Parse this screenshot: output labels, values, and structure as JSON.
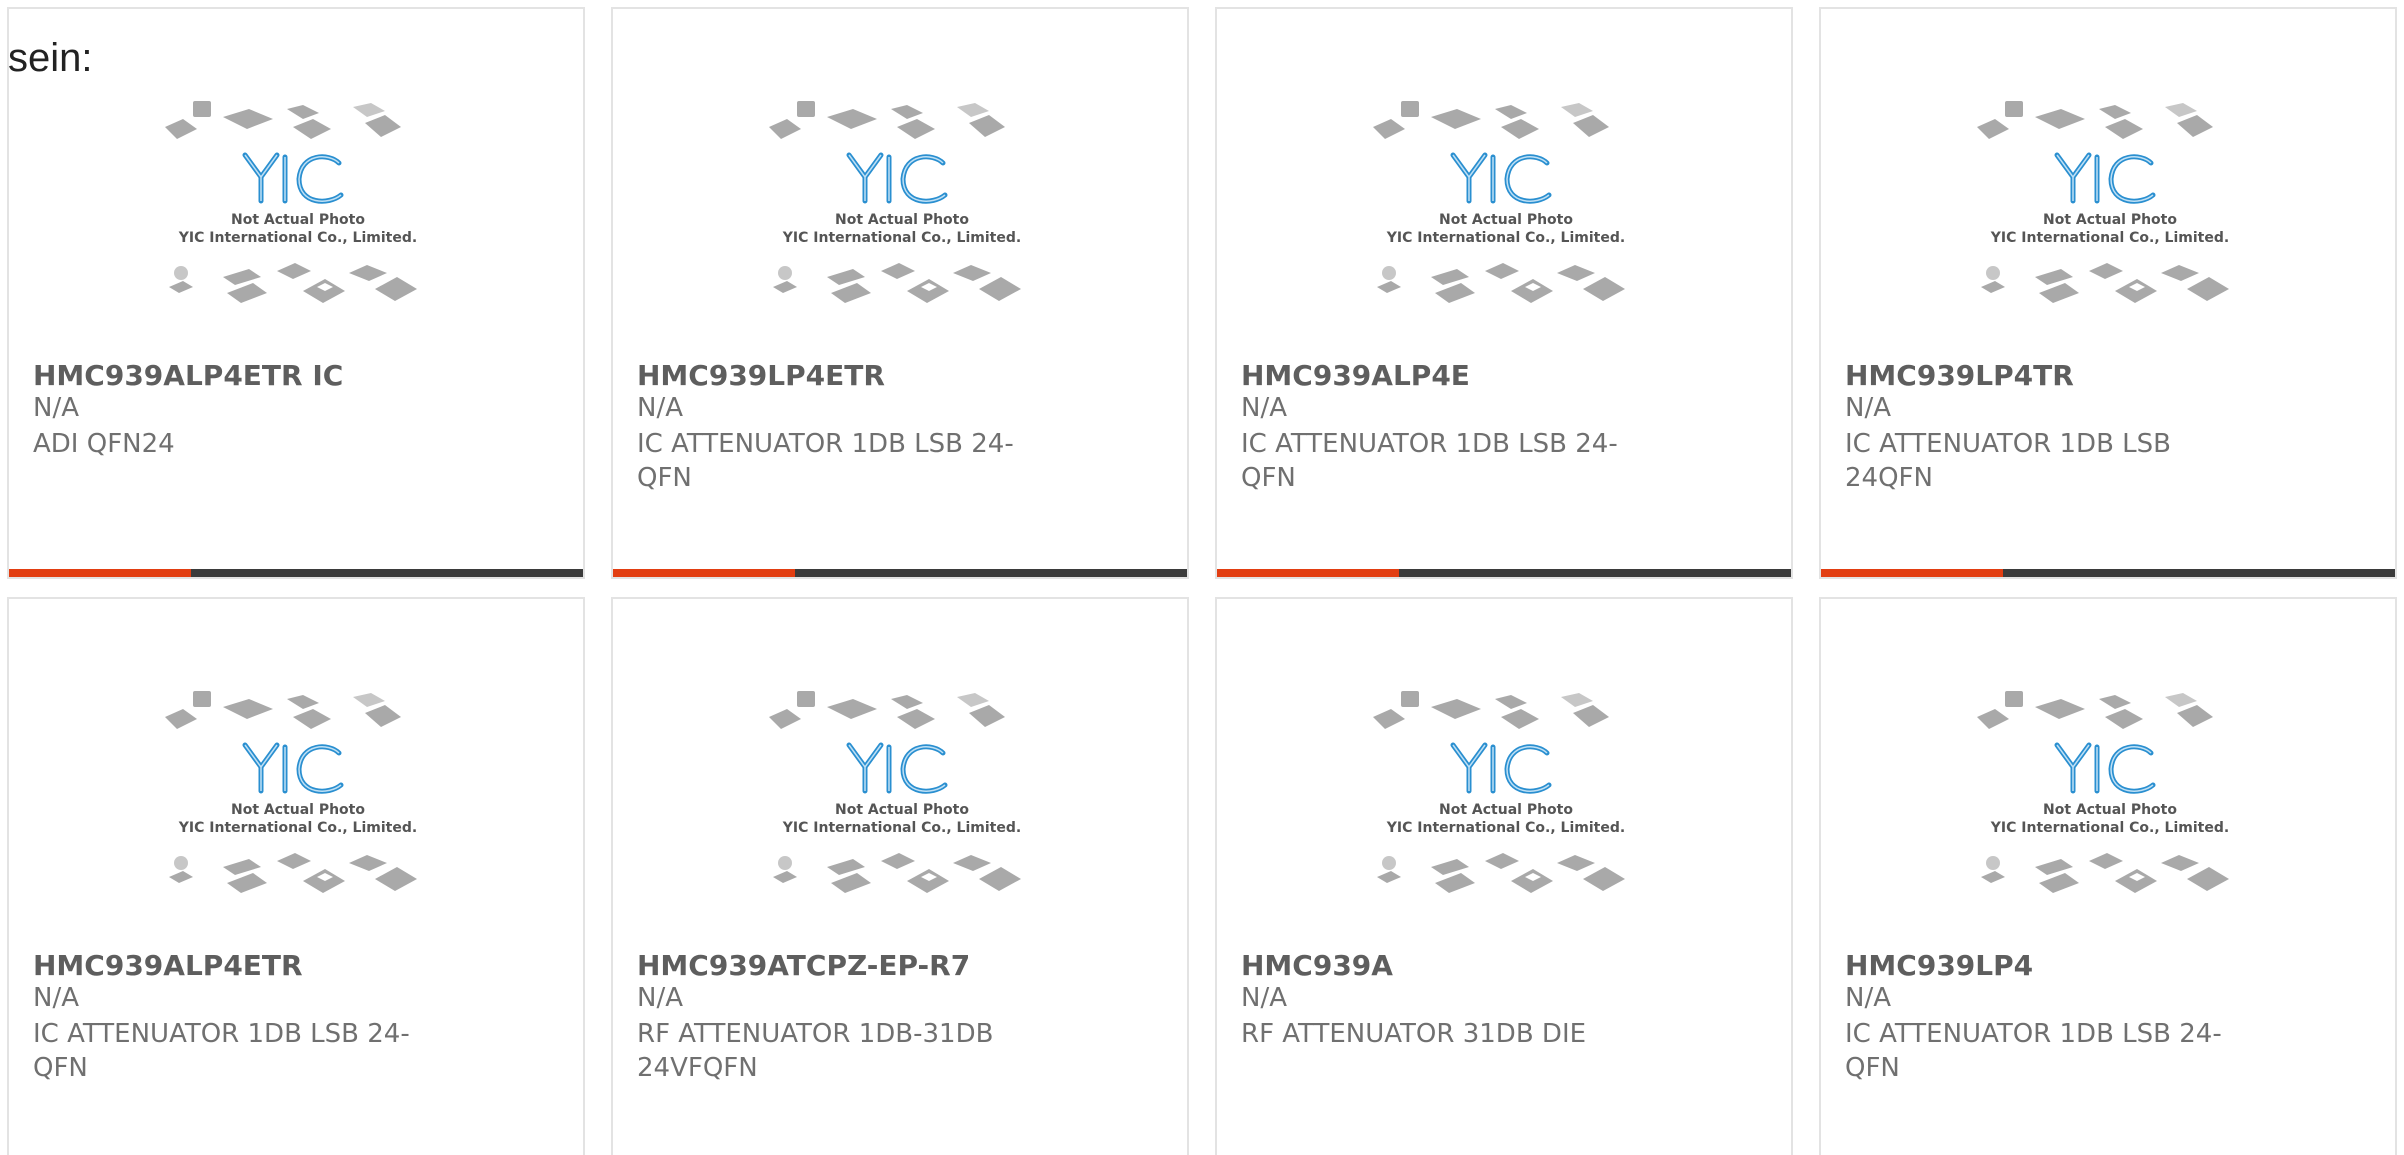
{
  "lead_text": "sein:",
  "brand": {
    "accent": "#e23e12",
    "bar": "#3b3b3b",
    "logo_blue": "#2a8fd0"
  },
  "placeholder": {
    "line1": "Not Actual Photo",
    "line2": "YIC International Co., Limited.",
    "logo": "YIC"
  },
  "products": [
    {
      "part": "HMC939ALP4ETR IC",
      "mfr": "N/A",
      "desc": "ADI QFN24"
    },
    {
      "part": "HMC939LP4ETR",
      "mfr": "N/A",
      "desc": "IC ATTENUATOR 1DB LSB 24-QFN"
    },
    {
      "part": "HMC939ALP4E",
      "mfr": "N/A",
      "desc": "IC ATTENUATOR 1DB LSB 24-QFN"
    },
    {
      "part": "HMC939LP4TR",
      "mfr": "N/A",
      "desc": "IC ATTENUATOR 1DB LSB 24QFN"
    },
    {
      "part": "HMC939ALP4ETR",
      "mfr": "N/A",
      "desc": "IC ATTENUATOR 1DB LSB 24-QFN"
    },
    {
      "part": "HMC939ATCPZ-EP-R7",
      "mfr": "N/A",
      "desc": "RF ATTENUATOR 1DB-31DB 24VFQFN"
    },
    {
      "part": "HMC939A",
      "mfr": "N/A",
      "desc": "RF ATTENUATOR 31DB DIE"
    },
    {
      "part": "HMC939LP4",
      "mfr": "N/A",
      "desc": "IC ATTENUATOR 1DB LSB 24-QFN"
    }
  ]
}
